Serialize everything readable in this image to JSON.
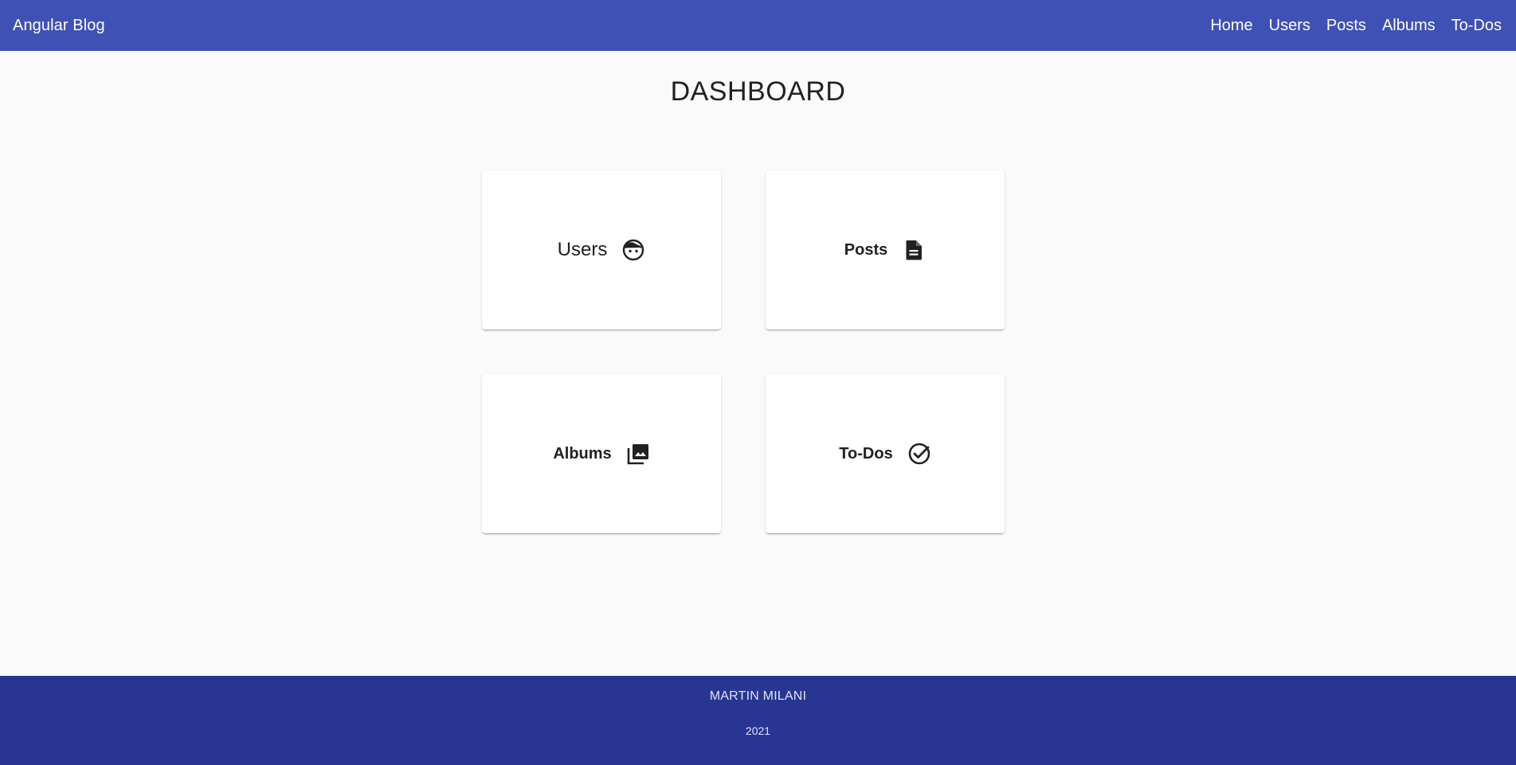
{
  "header": {
    "brand": "Angular Blog",
    "nav": [
      "Home",
      "Users",
      "Posts",
      "Albums",
      "To-Dos"
    ]
  },
  "main": {
    "title": "DASHBOARD",
    "cards": [
      {
        "label": "Users",
        "icon": "face-icon"
      },
      {
        "label": "Posts",
        "icon": "description-icon"
      },
      {
        "label": "Albums",
        "icon": "photo-library-icon"
      },
      {
        "label": "To-Dos",
        "icon": "check-circle-icon"
      }
    ]
  },
  "footer": {
    "name": "MARTIN MILANI",
    "year": "2021"
  },
  "colors": {
    "toolbar": "#3f51b5",
    "footer": "#283593",
    "background": "#fafafa"
  }
}
